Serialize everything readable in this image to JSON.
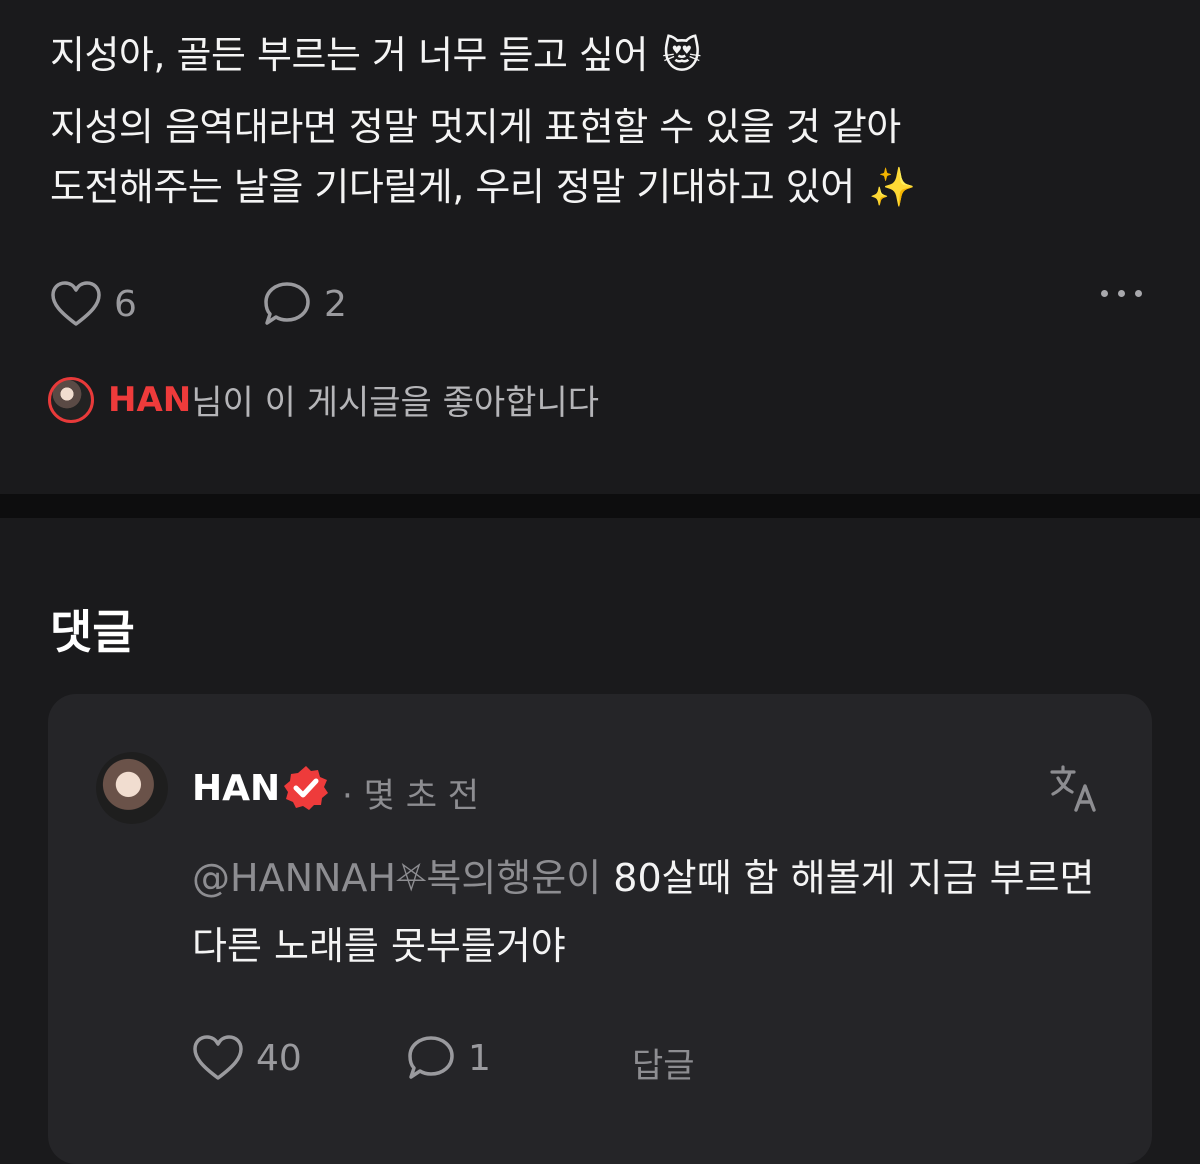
{
  "post": {
    "lines": [
      "지성아, 골든 부르는 거 너무 듣고 싶어",
      "지성의 음역대라면 정말 멋지게 표현할 수 있을 것 같아",
      "도전해주는 날을 기다릴게, 우리 정말 기대하고 있어"
    ],
    "emoji_line1": "😻",
    "emoji_line3": "✨",
    "like_count": "6",
    "comment_count": "2",
    "liked_by_name": "HAN",
    "liked_by_suffix": "님이 이 게시글을 좋아합니다"
  },
  "comments_section": {
    "title": "댓글",
    "comment": {
      "author": "HAN",
      "time": "· 몇 초 전",
      "mention": "@HANNAH⛧복의행운이",
      "text": " 80살때 함 해볼게 지금 부르면 다른 노래를 못부를거야",
      "like_count": "40",
      "reply_count": "1",
      "reply_label": "답글"
    }
  },
  "colors": {
    "background": "#1a1a1c",
    "card": "#252528",
    "accent_red": "#ee3b3b",
    "muted": "#8d8d91"
  },
  "icons": [
    "heart-icon",
    "speech-bubble-icon",
    "more-dots-icon",
    "verified-badge-icon",
    "translate-icon"
  ]
}
